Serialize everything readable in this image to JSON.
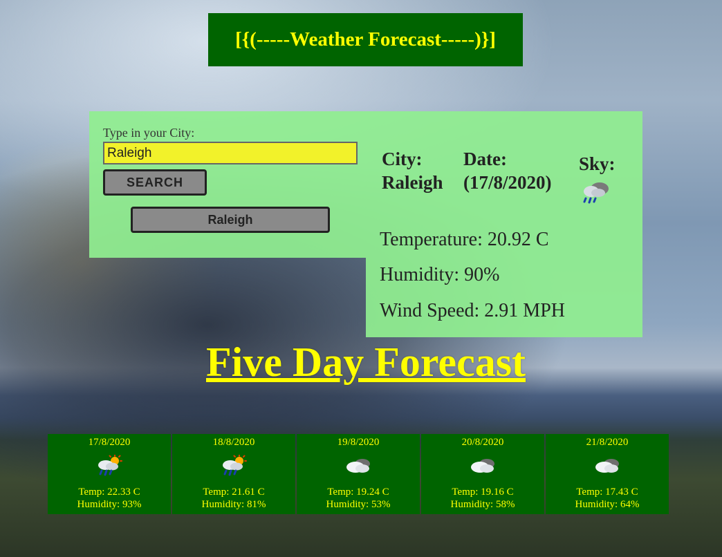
{
  "header": {
    "title": "[{(-----Weather Forecast-----)}]"
  },
  "search": {
    "label": "Type in your City:",
    "value": "Raleigh",
    "button_label": "SEARCH",
    "history": [
      "Raleigh"
    ]
  },
  "current": {
    "city_label": "City:",
    "city": "Raleigh",
    "date_label": "Date:",
    "date": "(17/8/2020)",
    "sky_label": "Sky:",
    "sky_icon": "rain-sun-cloud-icon",
    "temperature": "Temperature: 20.92 C",
    "humidity": "Humidity: 90%",
    "wind": "Wind Speed: 2.91 MPH"
  },
  "forecast": {
    "title": "Five Day Forecast",
    "days": [
      {
        "date": "17/8/2020",
        "icon": "rain-sun-cloud-icon",
        "temp": "Temp: 22.33 C",
        "humidity": "Humidity: 93%"
      },
      {
        "date": "18/8/2020",
        "icon": "rain-sun-cloud-icon",
        "temp": "Temp: 21.61 C",
        "humidity": "Humidity: 81%"
      },
      {
        "date": "19/8/2020",
        "icon": "cloud-icon",
        "temp": "Temp: 19.24 C",
        "humidity": "Humidity: 53%"
      },
      {
        "date": "20/8/2020",
        "icon": "cloud-icon",
        "temp": "Temp: 19.16 C",
        "humidity": "Humidity: 58%"
      },
      {
        "date": "21/8/2020",
        "icon": "cloud-icon",
        "temp": "Temp: 17.43 C",
        "humidity": "Humidity: 64%"
      }
    ]
  },
  "colors": {
    "header_bg": "#006400",
    "accent_yellow": "#ffff00",
    "panel_green": "#90ee90",
    "input_yellow": "#f2f22a",
    "button_gray": "#8a8a8a"
  }
}
